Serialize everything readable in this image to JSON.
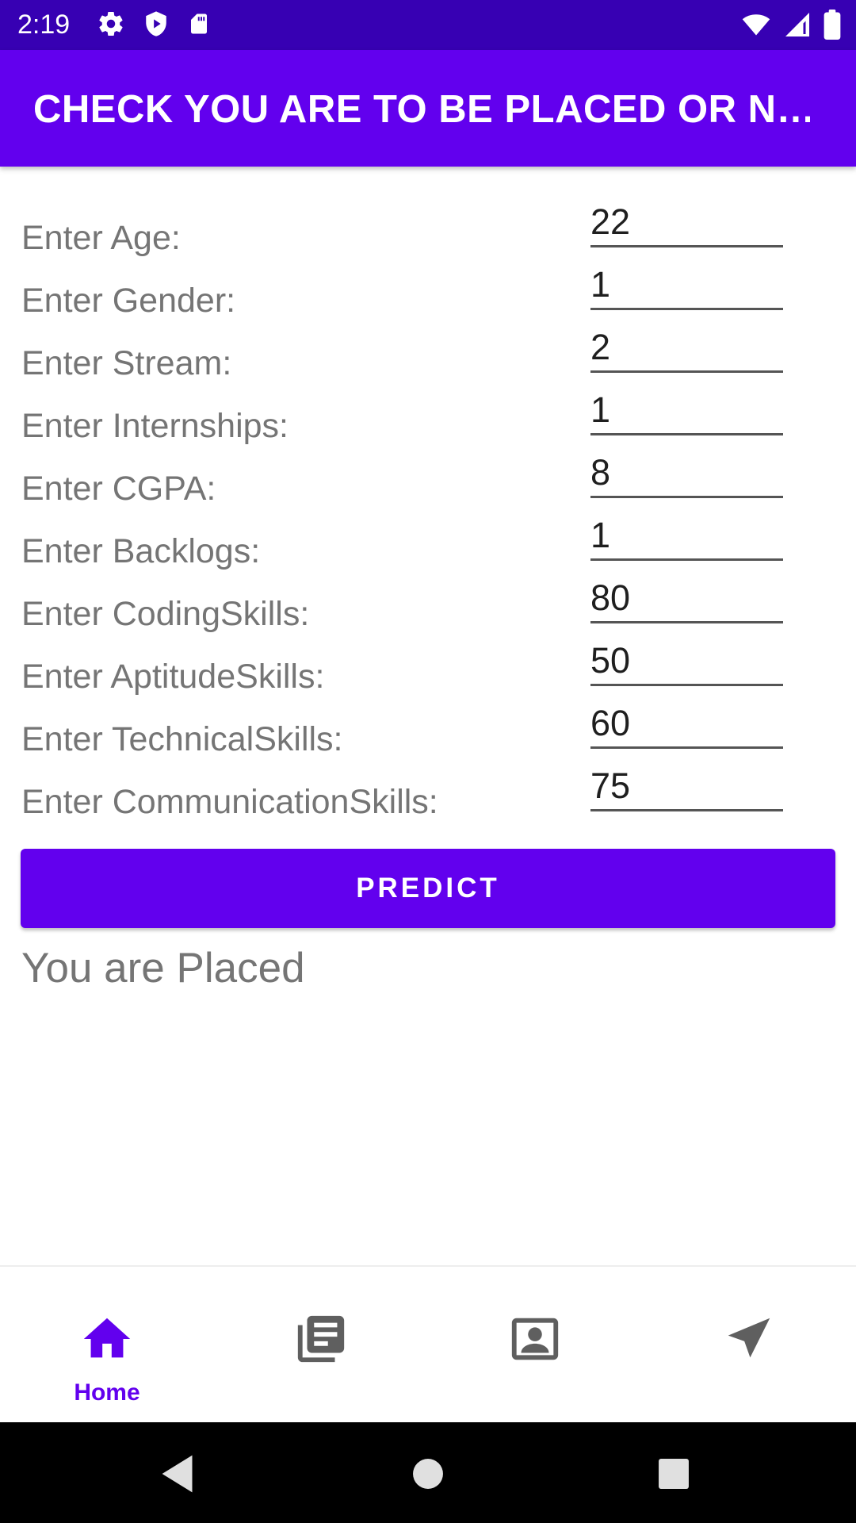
{
  "status_bar": {
    "time": "2:19",
    "left_icons": [
      "settings-icon",
      "shield-play-icon",
      "sd-card-icon"
    ],
    "right_icons": [
      "wifi-icon",
      "signal-icon",
      "battery-icon"
    ]
  },
  "app_bar": {
    "title": "CHECK YOU ARE TO BE  PLACED OR N…"
  },
  "form": {
    "fields": [
      {
        "label": "Enter Age:",
        "value": "22"
      },
      {
        "label": "Enter Gender:",
        "value": "1"
      },
      {
        "label": "Enter Stream:",
        "value": "2"
      },
      {
        "label": "Enter Internships:",
        "value": "1"
      },
      {
        "label": "Enter CGPA:",
        "value": "8"
      },
      {
        "label": "Enter Backlogs:",
        "value": "1"
      },
      {
        "label": "Enter CodingSkills:",
        "value": "80"
      },
      {
        "label": "Enter AptitudeSkills:",
        "value": "50"
      },
      {
        "label": "Enter TechnicalSkills:",
        "value": "60"
      },
      {
        "label": "Enter CommunicationSkills:",
        "value": "75"
      }
    ],
    "predict_label": "PREDICT",
    "result": "You are Placed"
  },
  "bottom_nav": {
    "items": [
      {
        "label": "Home",
        "icon": "home-icon",
        "active": true
      },
      {
        "label": "",
        "icon": "article-icon",
        "active": false
      },
      {
        "label": "",
        "icon": "contact-card-icon",
        "active": false
      },
      {
        "label": "",
        "icon": "send-icon",
        "active": false
      }
    ]
  },
  "colors": {
    "primary": "#6200ee",
    "primary_dark": "#3700b3",
    "label_gray": "#757575",
    "icon_gray": "#5f5f5f"
  }
}
